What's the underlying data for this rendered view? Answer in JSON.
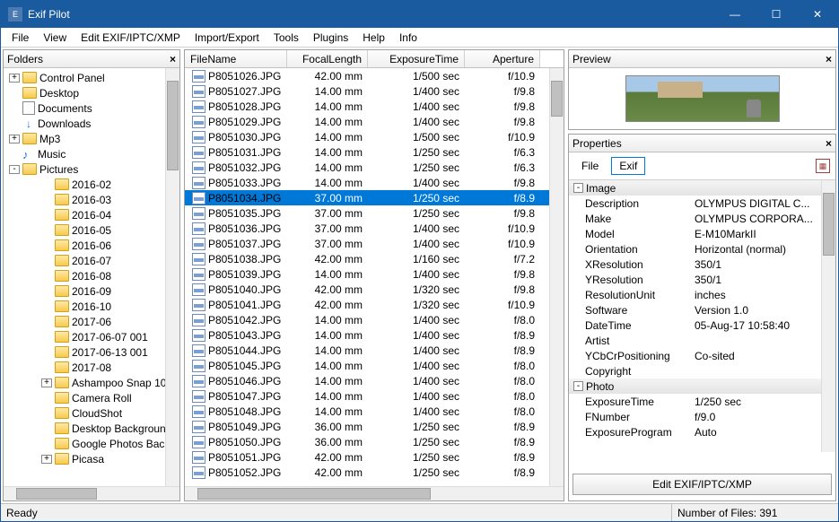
{
  "window": {
    "title": "Exif Pilot"
  },
  "menu": [
    "File",
    "View",
    "Edit EXIF/IPTC/XMP",
    "Import/Export",
    "Tools",
    "Plugins",
    "Help",
    "Info"
  ],
  "panes": {
    "folders": "Folders",
    "preview": "Preview",
    "properties": "Properties"
  },
  "tree": [
    {
      "indent": 0,
      "exp": "+",
      "icon": "folder",
      "label": "Control Panel"
    },
    {
      "indent": 0,
      "exp": "",
      "icon": "folder",
      "label": "Desktop"
    },
    {
      "indent": 0,
      "exp": "",
      "icon": "doc",
      "label": "Documents"
    },
    {
      "indent": 0,
      "exp": "",
      "icon": "dl",
      "label": "Downloads"
    },
    {
      "indent": 0,
      "exp": "+",
      "icon": "folder",
      "label": "Mp3"
    },
    {
      "indent": 0,
      "exp": "",
      "icon": "music",
      "label": "Music"
    },
    {
      "indent": 0,
      "exp": "-",
      "icon": "folder",
      "label": "Pictures"
    },
    {
      "indent": 1,
      "exp": "",
      "icon": "folder",
      "label": "2016-02"
    },
    {
      "indent": 1,
      "exp": "",
      "icon": "folder",
      "label": "2016-03"
    },
    {
      "indent": 1,
      "exp": "",
      "icon": "folder",
      "label": "2016-04"
    },
    {
      "indent": 1,
      "exp": "",
      "icon": "folder",
      "label": "2016-05"
    },
    {
      "indent": 1,
      "exp": "",
      "icon": "folder",
      "label": "2016-06"
    },
    {
      "indent": 1,
      "exp": "",
      "icon": "folder",
      "label": "2016-07"
    },
    {
      "indent": 1,
      "exp": "",
      "icon": "folder",
      "label": "2016-08"
    },
    {
      "indent": 1,
      "exp": "",
      "icon": "folder",
      "label": "2016-09"
    },
    {
      "indent": 1,
      "exp": "",
      "icon": "folder",
      "label": "2016-10"
    },
    {
      "indent": 1,
      "exp": "",
      "icon": "folder",
      "label": "2017-06"
    },
    {
      "indent": 1,
      "exp": "",
      "icon": "folder",
      "label": "2017-06-07 001"
    },
    {
      "indent": 1,
      "exp": "",
      "icon": "folder",
      "label": "2017-06-13 001"
    },
    {
      "indent": 1,
      "exp": "",
      "icon": "folder",
      "label": "2017-08"
    },
    {
      "indent": 1,
      "exp": "+",
      "icon": "folder",
      "label": "Ashampoo Snap 10"
    },
    {
      "indent": 1,
      "exp": "",
      "icon": "folder",
      "label": "Camera Roll"
    },
    {
      "indent": 1,
      "exp": "",
      "icon": "folder",
      "label": "CloudShot"
    },
    {
      "indent": 1,
      "exp": "",
      "icon": "folder",
      "label": "Desktop Background"
    },
    {
      "indent": 1,
      "exp": "",
      "icon": "folder",
      "label": "Google Photos Bac"
    },
    {
      "indent": 1,
      "exp": "+",
      "icon": "folder",
      "label": "Picasa"
    }
  ],
  "file_columns": [
    "FileName",
    "FocalLength",
    "ExposureTime",
    "Aperture"
  ],
  "files": [
    {
      "n": "P8051026.JPG",
      "f": "42.00 mm",
      "e": "1/500 sec",
      "a": "f/10.9"
    },
    {
      "n": "P8051027.JPG",
      "f": "14.00 mm",
      "e": "1/400 sec",
      "a": "f/9.8"
    },
    {
      "n": "P8051028.JPG",
      "f": "14.00 mm",
      "e": "1/400 sec",
      "a": "f/9.8"
    },
    {
      "n": "P8051029.JPG",
      "f": "14.00 mm",
      "e": "1/400 sec",
      "a": "f/9.8"
    },
    {
      "n": "P8051030.JPG",
      "f": "14.00 mm",
      "e": "1/500 sec",
      "a": "f/10.9"
    },
    {
      "n": "P8051031.JPG",
      "f": "14.00 mm",
      "e": "1/250 sec",
      "a": "f/6.3"
    },
    {
      "n": "P8051032.JPG",
      "f": "14.00 mm",
      "e": "1/250 sec",
      "a": "f/6.3"
    },
    {
      "n": "P8051033.JPG",
      "f": "14.00 mm",
      "e": "1/400 sec",
      "a": "f/9.8"
    },
    {
      "n": "P8051034.JPG",
      "f": "37.00 mm",
      "e": "1/250 sec",
      "a": "f/8.9",
      "sel": true
    },
    {
      "n": "P8051035.JPG",
      "f": "37.00 mm",
      "e": "1/250 sec",
      "a": "f/9.8"
    },
    {
      "n": "P8051036.JPG",
      "f": "37.00 mm",
      "e": "1/400 sec",
      "a": "f/10.9"
    },
    {
      "n": "P8051037.JPG",
      "f": "37.00 mm",
      "e": "1/400 sec",
      "a": "f/10.9"
    },
    {
      "n": "P8051038.JPG",
      "f": "42.00 mm",
      "e": "1/160 sec",
      "a": "f/7.2"
    },
    {
      "n": "P8051039.JPG",
      "f": "14.00 mm",
      "e": "1/400 sec",
      "a": "f/9.8"
    },
    {
      "n": "P8051040.JPG",
      "f": "42.00 mm",
      "e": "1/320 sec",
      "a": "f/9.8"
    },
    {
      "n": "P8051041.JPG",
      "f": "42.00 mm",
      "e": "1/320 sec",
      "a": "f/10.9"
    },
    {
      "n": "P8051042.JPG",
      "f": "14.00 mm",
      "e": "1/400 sec",
      "a": "f/8.0"
    },
    {
      "n": "P8051043.JPG",
      "f": "14.00 mm",
      "e": "1/400 sec",
      "a": "f/8.9"
    },
    {
      "n": "P8051044.JPG",
      "f": "14.00 mm",
      "e": "1/400 sec",
      "a": "f/8.9"
    },
    {
      "n": "P8051045.JPG",
      "f": "14.00 mm",
      "e": "1/400 sec",
      "a": "f/8.0"
    },
    {
      "n": "P8051046.JPG",
      "f": "14.00 mm",
      "e": "1/400 sec",
      "a": "f/8.0"
    },
    {
      "n": "P8051047.JPG",
      "f": "14.00 mm",
      "e": "1/400 sec",
      "a": "f/8.0"
    },
    {
      "n": "P8051048.JPG",
      "f": "14.00 mm",
      "e": "1/400 sec",
      "a": "f/8.0"
    },
    {
      "n": "P8051049.JPG",
      "f": "36.00 mm",
      "e": "1/250 sec",
      "a": "f/8.9"
    },
    {
      "n": "P8051050.JPG",
      "f": "36.00 mm",
      "e": "1/250 sec",
      "a": "f/8.9"
    },
    {
      "n": "P8051051.JPG",
      "f": "42.00 mm",
      "e": "1/250 sec",
      "a": "f/8.9"
    },
    {
      "n": "P8051052.JPG",
      "f": "42.00 mm",
      "e": "1/250 sec",
      "a": "f/8.9"
    }
  ],
  "props_tabs": {
    "file": "File",
    "exif": "Exif"
  },
  "props": [
    {
      "group": true,
      "k": "Image"
    },
    {
      "k": "Description",
      "v": "OLYMPUS DIGITAL C..."
    },
    {
      "k": "Make",
      "v": "OLYMPUS CORPORA..."
    },
    {
      "k": "Model",
      "v": "E-M10MarkII"
    },
    {
      "k": "Orientation",
      "v": "Horizontal (normal)"
    },
    {
      "k": "XResolution",
      "v": "350/1"
    },
    {
      "k": "YResolution",
      "v": "350/1"
    },
    {
      "k": "ResolutionUnit",
      "v": "inches"
    },
    {
      "k": "Software",
      "v": "Version 1.0"
    },
    {
      "k": "DateTime",
      "v": "05-Aug-17 10:58:40"
    },
    {
      "k": "Artist",
      "v": ""
    },
    {
      "k": "YCbCrPositioning",
      "v": "Co-sited"
    },
    {
      "k": "Copyright",
      "v": ""
    },
    {
      "group": true,
      "k": "Photo"
    },
    {
      "k": "ExposureTime",
      "v": "1/250 sec"
    },
    {
      "k": "FNumber",
      "v": "f/9.0"
    },
    {
      "k": "ExposureProgram",
      "v": "Auto"
    }
  ],
  "edit_button": "Edit EXIF/IPTC/XMP",
  "status": {
    "ready": "Ready",
    "count": "Number of Files: 391"
  }
}
